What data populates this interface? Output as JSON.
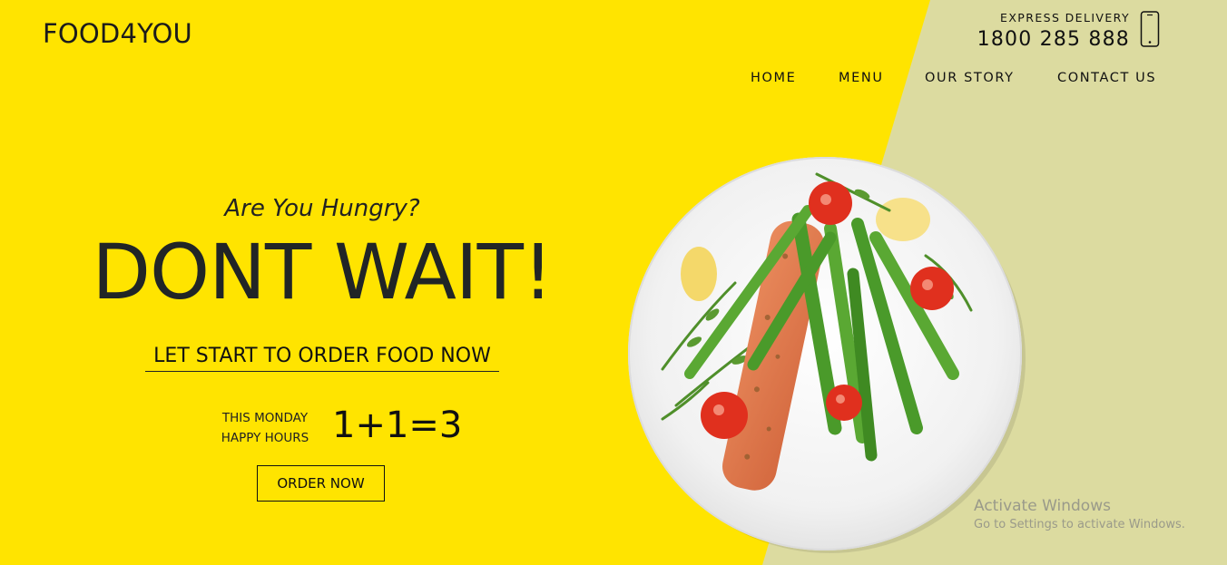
{
  "brand": {
    "logo": "FOOD4YOU"
  },
  "header": {
    "delivery_label": "EXPRESS DELIVERY",
    "phone": "1800 285 888",
    "phone_icon": "smartphone-icon"
  },
  "nav": {
    "items": [
      {
        "label": "HOME"
      },
      {
        "label": "MENU"
      },
      {
        "label": "OUR STORY"
      },
      {
        "label": "CONTACT US"
      }
    ]
  },
  "hero": {
    "tagline": "Are You Hungry?",
    "headline": "DONT WAIT!",
    "subheadline": "LET START TO ORDER FOOD NOW",
    "promo_line1": "THIS MONDAY",
    "promo_line2": "HAPPY HOURS",
    "promo_deal": "1+1=3",
    "cta_label": "ORDER NOW"
  },
  "image": {
    "subject": "salmon-asparagus-plate"
  },
  "watermark": {
    "line1": "Activate Windows",
    "line2": "Go to Settings to activate Windows."
  },
  "colors": {
    "yellow": "#ffe400",
    "olive": "#dcdba0",
    "text_dark": "#212526"
  }
}
